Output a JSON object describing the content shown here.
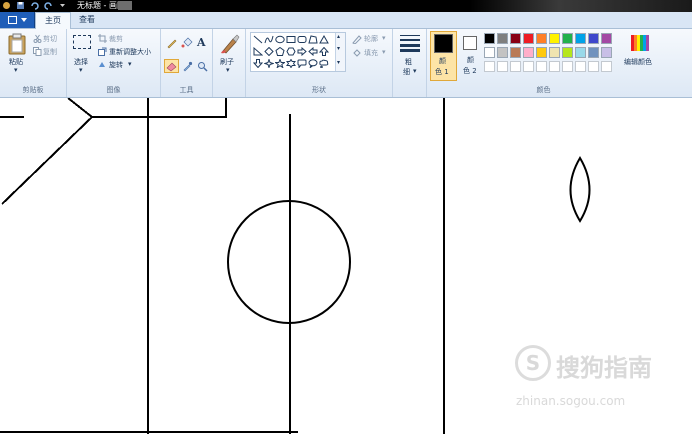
{
  "window": {
    "title": "无标题 - 画图"
  },
  "tabs": {
    "home": "主页",
    "view": "查看"
  },
  "clipboard": {
    "paste": "粘贴",
    "cut": "剪切",
    "copy": "复制",
    "group": "剪贴板"
  },
  "image": {
    "select": "选择",
    "crop": "裁剪",
    "resize": "重新调整大小",
    "rotate": "旋转",
    "group": "图像"
  },
  "tools": {
    "group": "工具"
  },
  "brushes": {
    "label": "刷子"
  },
  "shapes": {
    "outline": "轮廓",
    "fill": "填充",
    "group": "形状"
  },
  "size": {
    "label_line1": "粗",
    "label_line2": "细"
  },
  "colors": {
    "color1_line1": "颜",
    "color1_line2": "色 1",
    "color2_line1": "颜",
    "color2_line2": "色 2",
    "edit": "编辑颜色",
    "group": "颜色",
    "color1_value": "#000000",
    "color2_value": "#ffffff",
    "palette_row1": [
      "#000000",
      "#7f7f7f",
      "#880015",
      "#ed1c24",
      "#ff7f27",
      "#fff200",
      "#22b14c",
      "#00a2e8",
      "#3f48cc",
      "#a349a4"
    ],
    "palette_row2": [
      "#ffffff",
      "#c3c3c3",
      "#b97a57",
      "#ffaec9",
      "#ffc90e",
      "#efe4b0",
      "#b5e61d",
      "#99d9ea",
      "#7092be",
      "#c8bfe7"
    ]
  },
  "watermark": {
    "brand": "搜狗指南",
    "url": "zhinan.sogou.com"
  }
}
